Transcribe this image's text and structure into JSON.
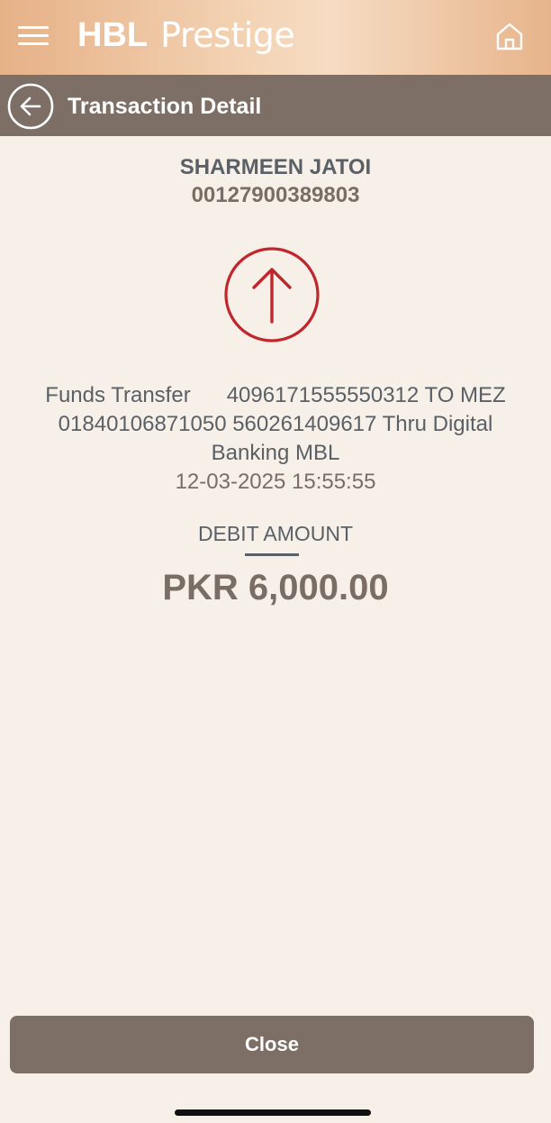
{
  "header": {
    "brand_logo": "HBL",
    "brand_name": "Prestige",
    "menu_icon": "hamburger-menu-icon",
    "home_icon": "home-icon"
  },
  "subheader": {
    "back_icon": "back-arrow-icon",
    "title": "Transaction Detail"
  },
  "account": {
    "name": "SHARMEEN JATOI",
    "number": "00127900389803"
  },
  "transaction": {
    "icon": "debit-arrow-up-icon",
    "icon_color": "#c0272d",
    "description": "Funds Transfer      4096171555550312 TO MEZ 01840106871050 560261409617 Thru Digital Banking MBL",
    "datetime": "12-03-2025 15:55:55",
    "amount_label": "DEBIT AMOUNT",
    "amount": "PKR 6,000.00"
  },
  "footer": {
    "close_label": "Close"
  },
  "colors": {
    "background": "#f6f0e9",
    "bar": "#7d6f66",
    "accent": "#c0272d"
  }
}
